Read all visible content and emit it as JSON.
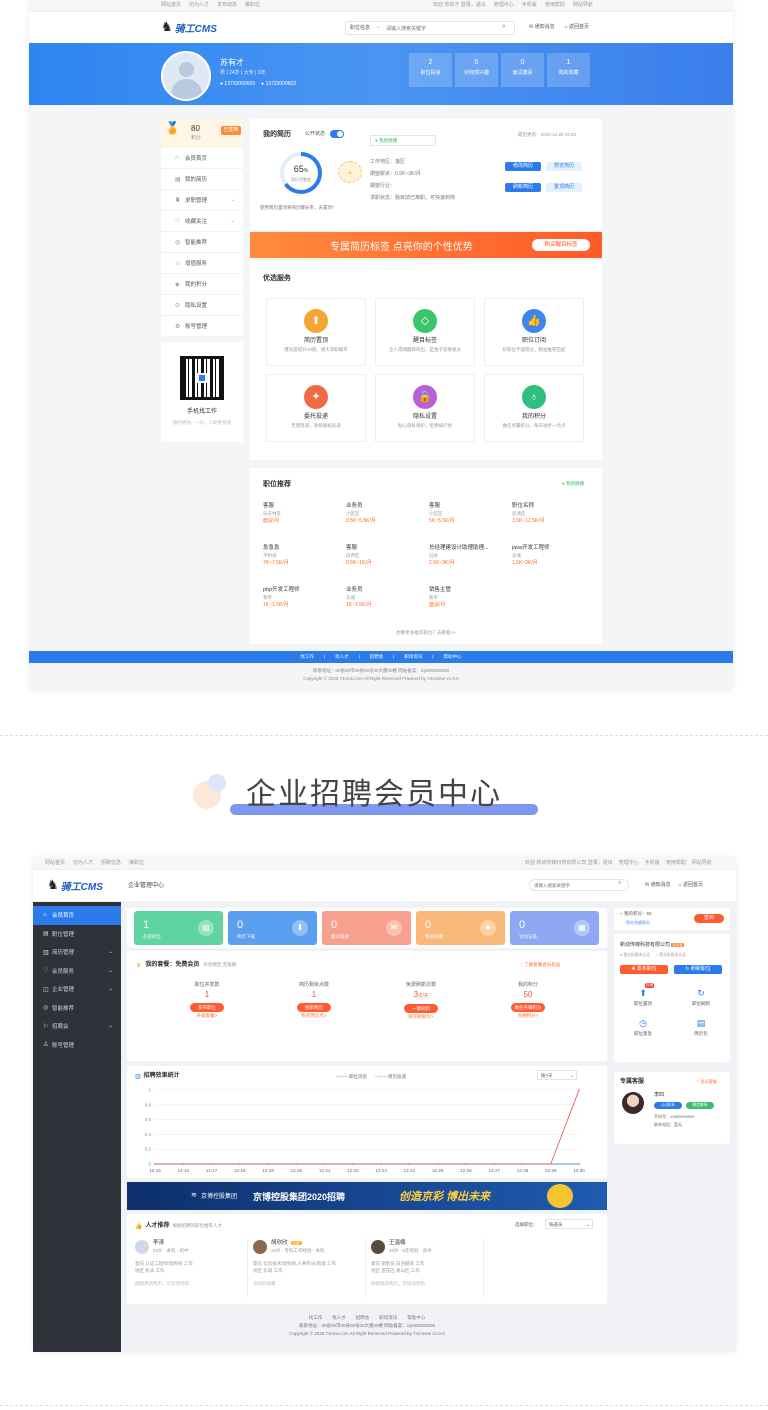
{
  "s1": {
    "topbar": {
      "left": [
        "网站首页",
        "切为人才",
        "发布动态",
        "推职位"
      ],
      "right": [
        "欢迎 苏有才 登录，退出",
        "管理中心",
        "手机版",
        "使用帮助",
        "网站导航"
      ]
    },
    "logo": "骑工CMS",
    "search": {
      "type": "职位信息",
      "placeholder": "请输入搜索关键字"
    },
    "nav": {
      "messages": "通知消息",
      "home": "返回首页"
    },
    "profile": {
      "name": "苏有才",
      "info": "男 | 24岁 | 大专 | 3年",
      "phone1": "13733000603",
      "phone2": "13733000603"
    },
    "stats": [
      {
        "value": "2",
        "label": "职位投递"
      },
      {
        "value": "0",
        "label": "对我感兴趣"
      },
      {
        "value": "0",
        "label": "面试邀请"
      },
      {
        "value": "1",
        "label": "我的收藏"
      }
    ],
    "points": {
      "value": "80",
      "label": "积分",
      "btn": "已签到"
    },
    "menu": [
      {
        "icon": "⌂",
        "label": "会员首页"
      },
      {
        "icon": "▤",
        "label": "我的简历"
      },
      {
        "icon": "♜",
        "label": "求职管理",
        "arrow": "⌄"
      },
      {
        "icon": "♡",
        "label": "收藏关注",
        "arrow": "⌄"
      },
      {
        "icon": "◎",
        "label": "智能推荐"
      },
      {
        "icon": "☆",
        "label": "增值服务"
      },
      {
        "icon": "◈",
        "label": "我的积分"
      },
      {
        "icon": "⊙",
        "label": "隐私设置"
      },
      {
        "icon": "⚙",
        "label": "账号管理"
      }
    ],
    "qr": {
      "title": "手机找工作",
      "sub": "随时随地，一扫，人职更快速"
    },
    "resume": {
      "title": "我的简历",
      "public": "公开状态",
      "percent": "65",
      "percent_unit": "%",
      "percent_label": "简历完整度",
      "status": "● 我想跳槽",
      "updated": "最后更新：2020-12-25 19:20",
      "l1": "工作地区：莲区",
      "l2": "期望薪资：0.5K~3K/月",
      "l3": "期望行业：",
      "l4": "求职状态：我目前已离职，可快速到岗",
      "tip": "使用简历置顶将简历曝光率，去置顶！",
      "b1": "修改简历",
      "b2": "预览简历",
      "b3": "刷新简历",
      "b4": "置顶简历"
    },
    "banner": {
      "text": "专属简历标签 点亮你的个性优势",
      "btn": "购买醒目标签"
    },
    "services": {
      "title": "优选服务",
      "items": [
        {
          "icon": "⬆",
          "color": "#f7a532",
          "name": "简历置顶",
          "desc": "曝光度提升10倍，增大求职概率"
        },
        {
          "icon": "◇",
          "color": "#3cc46c",
          "name": "醒目标签",
          "desc": "企人得闻醒目阵出，是金子就要发光"
        },
        {
          "icon": "👍",
          "color": "#3c86ee",
          "name": "职位订阅",
          "desc": "好职位不能错过，精准推荐匹配"
        },
        {
          "icon": "✦",
          "color": "#f26a44",
          "name": "委托投递",
          "desc": "无需登录，系统随机投递"
        },
        {
          "icon": "🔒",
          "color": "#b95fd8",
          "name": "隐私设置",
          "desc": "贴心隐私保护，拒绝被打扰"
        },
        {
          "icon": "♁",
          "color": "#2fbf7f",
          "name": "我的积分",
          "desc": "做任务赢积分，每天进步一点点"
        }
      ]
    },
    "jobs": {
      "title": "职位推荐",
      "tag": "● 我想跳槽",
      "items": [
        {
          "n": "客服",
          "l": "乐东林区",
          "s": "面议/月"
        },
        {
          "n": "业务员",
          "l": "小区区",
          "s": "0.5K~5.5K/月"
        },
        {
          "n": "客服",
          "l": "小区区",
          "s": "5K~5.5K/月"
        },
        {
          "n": "职位名称",
          "l": "武清区",
          "s": "3.5K~12.5K/月"
        },
        {
          "n": "急急急",
          "l": "平桥县",
          "s": "7K~7.5K/月"
        },
        {
          "n": "客服",
          "l": "白界区",
          "s": "0.5K~1K/月"
        },
        {
          "n": "总经理建设计助理助理...",
          "l": "冠县",
          "s": "2.5K~3K/月"
        },
        {
          "n": "java开发工程师",
          "l": "东城",
          "s": "1.5K~2K/月"
        },
        {
          "n": "php开发工程师",
          "l": "和平",
          "s": "1K~1.5K/月"
        },
        {
          "n": "业务员",
          "l": "东城",
          "s": "1K~1.5K/月"
        },
        {
          "n": "销售主管",
          "l": "和平",
          "s": "面议/月"
        }
      ],
      "more": "想看更多推荐职位？去看看>>"
    },
    "footer": {
      "links": [
        "找工作",
        "找人才",
        "招聘会",
        "职场资讯",
        "帮助中心"
      ],
      "line1": "联系地址：00省00市00县00号00大厦00楼 网站备案：icp000000000",
      "line2": "Copyright © 2020 74cms.com All Right Reserved Powered by 74cmsse v1.0.0"
    }
  },
  "section_title": "企业招聘会员中心",
  "s2": {
    "topbar": {
      "left": [
        "网站首页",
        "切为人才",
        "招聘信息",
        "推职位"
      ],
      "right": [
        "欢迎 新动传媒科技有限公司 登录，退出",
        "管理中心",
        "手机版",
        "使用帮助",
        "网站导航"
      ]
    },
    "logo": "骑工CMS",
    "center": "企业管理中心",
    "search_placeholder": "请输入搜索关键字",
    "nav": {
      "messages": "通知消息",
      "home": "返回首页"
    },
    "menu": [
      {
        "icon": "⌂",
        "label": "会员首页",
        "active": true
      },
      {
        "icon": "▤",
        "label": "职位管理"
      },
      {
        "icon": "▥",
        "label": "简历管理",
        "arrow": "⌄"
      },
      {
        "icon": "♡",
        "label": "会员服务",
        "arrow": "⌄"
      },
      {
        "icon": "◫",
        "label": "企业管理",
        "arrow": "⌄"
      },
      {
        "icon": "◎",
        "label": "智能推荐"
      },
      {
        "icon": "⚐",
        "label": "招聘会",
        "arrow": "⌄"
      },
      {
        "icon": "♙",
        "label": "账号管理"
      }
    ],
    "stats": [
      {
        "value": "1",
        "label": "在招职位",
        "icon": "▤",
        "color": "#5fd4a0"
      },
      {
        "value": "0",
        "label": "简历下载",
        "icon": "⬇",
        "color": "#5a9ff0"
      },
      {
        "value": "0",
        "label": "面试邀请",
        "icon": "✉",
        "color": "#f7a08e"
      },
      {
        "value": "0",
        "label": "我的收藏",
        "icon": "★",
        "color": "#f9b87a"
      },
      {
        "value": "0",
        "label": "访问记录",
        "icon": "▦",
        "color": "#8fa8f3"
      }
    ],
    "package": {
      "title": "我的套餐：免费会员",
      "sub": "有效期至 无限期",
      "link": "了解套餐会员权益",
      "items": [
        {
          "t": "职位并发数",
          "v": "1",
          "b": "发布职位",
          "k": "升级套餐>"
        },
        {
          "t": "简历剩余点数",
          "v": "1",
          "b": "搜索简历",
          "k": "购买简历点>"
        },
        {
          "t": "免费刷新次数",
          "v": "3",
          "unit": "次/天",
          "b": "一键刷新",
          "k": "购买刷新包>"
        },
        {
          "t": "我的积分",
          "v": "50",
          "b": "做任务赚积分",
          "k": "兑换积分>"
        }
      ]
    },
    "chart_title": "招聘效果统计",
    "legend": [
      "职位浏览",
      "简历投递"
    ],
    "period": "按7天",
    "chart_data": {
      "type": "line",
      "x": [
        "12-15",
        "12-16",
        "12-17",
        "12-18",
        "12-19",
        "12-20",
        "12-21",
        "12-22",
        "12-23",
        "12-24",
        "12-25",
        "12-26",
        "12-27",
        "12-28",
        "12-29",
        "12-30"
      ],
      "series": [
        {
          "name": "职位浏览",
          "values": [
            0,
            0,
            0,
            0,
            0,
            0,
            0,
            0,
            0,
            0,
            0,
            0,
            0,
            0,
            0,
            0
          ]
        },
        {
          "name": "简历投递",
          "values": [
            0,
            0,
            0,
            0,
            0,
            0,
            0,
            0,
            0,
            0,
            0,
            0,
            0,
            0,
            0,
            1
          ]
        }
      ],
      "ylim": [
        0,
        1
      ],
      "yticks": [
        "0",
        "0.2",
        "0.4",
        "0.6",
        "0.8",
        "1"
      ]
    },
    "ad": {
      "brand": "京博控股集团",
      "text": "京博控股集团2020招聘",
      "slogan": "创造京彩 博出未来"
    },
    "talents": {
      "title": "人才推荐",
      "sub": "根据招聘的职位推荐人才",
      "filter_label": "选择职位：",
      "filter": "快递员",
      "items": [
        {
          "name": "李涛",
          "info": "23岁 · 本科 · 初中",
          "l1": "意向 认证工程师/架构师 工作",
          "l2": "地区 机床 工作",
          "time": "刚刚更新简历，可快速到岗"
        },
        {
          "name": "胡欣欣",
          "info": "25岁 · 专科工作经验 · 本科",
          "l1": "意向 信息技术/架构师,人事专员/助理 工作",
          "l2": "地区 东城 工作",
          "time": "添加到收藏",
          "badge": "认证"
        },
        {
          "name": "王温楠",
          "info": "28岁 · 5年经验 · 高中",
          "l1": "意向 销售员,日语翻译 工作",
          "l2": "地区 望花区,青山区 工作",
          "time": "刚刚更新简历，可快速到岗"
        }
      ]
    },
    "right": {
      "points_label": "我的积分：50",
      "points_link": "积分兑换积分",
      "sign_btn": "签到",
      "company": "新动传媒科技有限公司",
      "verify": "未认证",
      "tag1": "营业执照未认证",
      "tag2": "营业执照未认证",
      "btn1": "发布职位",
      "btn2": "刷新职位",
      "tools": [
        {
          "icon": "⬆",
          "label": "职位置顶",
          "badge": "热销"
        },
        {
          "icon": "↻",
          "label": "职位刷新"
        },
        {
          "icon": "◷",
          "label": "职位紧急"
        },
        {
          "icon": "▤",
          "label": "简历包"
        }
      ],
      "cs_title": "专属客服",
      "cs_link": "投诉客服",
      "cs_name": "李四",
      "cs_qq": "QQ联系",
      "cs_wx": "微信联系",
      "cs_phone": "手机号：13899999999",
      "cs_tel": "联系电话：暂无"
    },
    "footer": {
      "links": [
        "找工作",
        "找人才",
        "招聘会",
        "职场资讯",
        "帮助中心"
      ],
      "line1": "联系地址：00省00市00县00号00大厦00楼 网站备案：icp000000000",
      "line2": "Copyright © 2020 74cms.com All Right Reserved Powered by 74cmsse v1.0.0"
    }
  }
}
